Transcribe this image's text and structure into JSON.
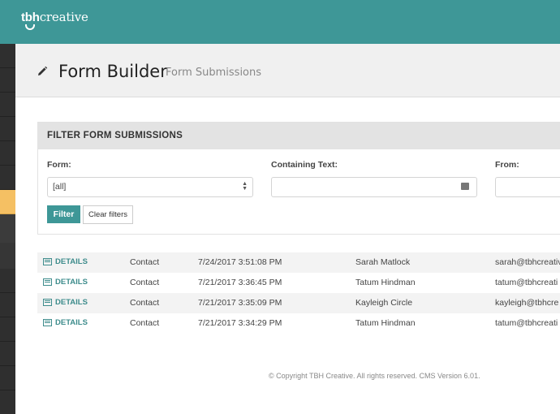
{
  "brand": {
    "logo_prefix": "tbh",
    "logo_suffix": "creative",
    "accent_color": "#3e9797",
    "active_nav_color": "#f5c063"
  },
  "sidebar": {
    "item_count": 15,
    "active_index": 6
  },
  "header": {
    "icon": "pencil-icon",
    "title": "Form Builder",
    "subtitle": "Form Submissions"
  },
  "filter": {
    "heading": "FILTER FORM SUBMISSIONS",
    "form_label": "Form:",
    "form_value": "[all]",
    "text_label": "Containing Text:",
    "text_value": "",
    "from_label": "From:",
    "from_value": "",
    "filter_button": "Filter",
    "clear_button": "Clear filters"
  },
  "submissions": [
    {
      "link": "DETAILS",
      "form": "Contact",
      "date": "7/24/2017 3:51:08 PM",
      "name": "Sarah Matlock",
      "email": "sarah@tbhcreativ"
    },
    {
      "link": "DETAILS",
      "form": "Contact",
      "date": "7/21/2017 3:36:45 PM",
      "name": "Tatum Hindman",
      "email": "tatum@tbhcreati"
    },
    {
      "link": "DETAILS",
      "form": "Contact",
      "date": "7/21/2017 3:35:09 PM",
      "name": "Kayleigh Circle",
      "email": "kayleigh@tbhcre"
    },
    {
      "link": "DETAILS",
      "form": "Contact",
      "date": "7/21/2017 3:34:29 PM",
      "name": "Tatum Hindman",
      "email": "tatum@tbhcreati"
    }
  ],
  "footer": {
    "text": "© Copyright TBH Creative. All rights reserved. CMS Version 6.01."
  }
}
